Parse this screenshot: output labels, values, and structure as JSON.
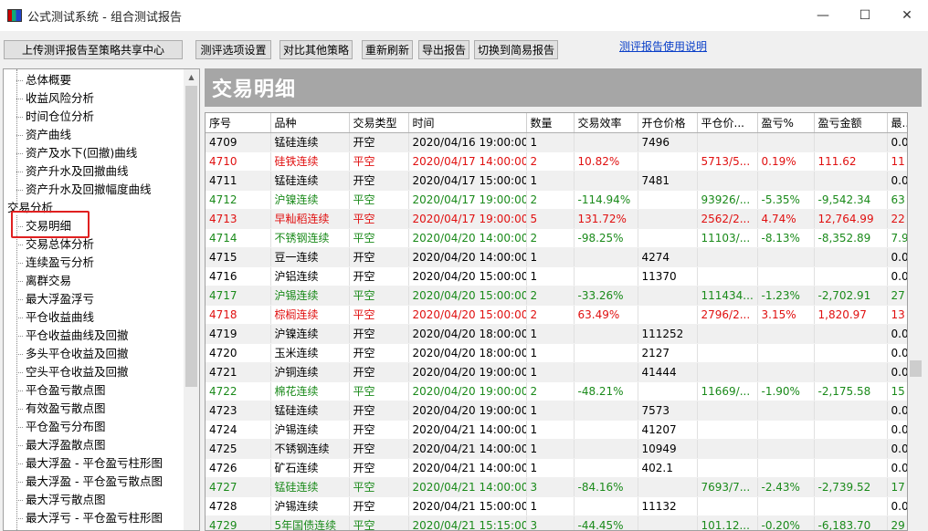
{
  "window": {
    "title": "公式测试系统 - 组合测试报告",
    "controls": {
      "minimize": "—",
      "maximize": "☐",
      "close": "✕"
    }
  },
  "toolbar": {
    "upload": "上传测评报告至策略共享中心",
    "options": "测评选项设置",
    "compare": "对比其他策略",
    "refresh": "重新刷新",
    "export": "导出报告",
    "switch": "切换到简易报告",
    "help_link": "测评报告使用说明"
  },
  "sidebar": {
    "items": [
      {
        "label": "总体概要",
        "child": true
      },
      {
        "label": "收益风险分析",
        "child": true
      },
      {
        "label": "时间仓位分析",
        "child": true
      },
      {
        "label": "资产曲线",
        "child": true
      },
      {
        "label": "资产及水下(回撤)曲线",
        "child": true
      },
      {
        "label": "资产升水及回撤曲线",
        "child": true
      },
      {
        "label": "资产升水及回撤幅度曲线",
        "child": true
      },
      {
        "label": "交易分析",
        "child": false
      },
      {
        "label": "交易明细",
        "child": true,
        "selected": true
      },
      {
        "label": "交易总体分析",
        "child": true
      },
      {
        "label": "连续盈亏分析",
        "child": true
      },
      {
        "label": "离群交易",
        "child": true
      },
      {
        "label": "最大浮盈浮亏",
        "child": true
      },
      {
        "label": "平仓收益曲线",
        "child": true
      },
      {
        "label": "平仓收益曲线及回撤",
        "child": true
      },
      {
        "label": "多头平仓收益及回撤",
        "child": true
      },
      {
        "label": "空头平仓收益及回撤",
        "child": true
      },
      {
        "label": "平仓盈亏散点图",
        "child": true
      },
      {
        "label": "有效盈亏散点图",
        "child": true
      },
      {
        "label": "平仓盈亏分布图",
        "child": true
      },
      {
        "label": "最大浮盈散点图",
        "child": true
      },
      {
        "label": "最大浮盈 - 平仓盈亏柱形图",
        "child": true
      },
      {
        "label": "最大浮盈 - 平仓盈亏散点图",
        "child": true
      },
      {
        "label": "最大浮亏散点图",
        "child": true
      },
      {
        "label": "最大浮亏 - 平仓盈亏柱形图",
        "child": true
      },
      {
        "label": "最大浮亏 - 平仓盈亏散点图",
        "child": true
      }
    ]
  },
  "main": {
    "section_title": "交易明细",
    "columns": [
      "序号",
      "品种",
      "交易类型",
      "时间",
      "数量",
      "交易效率",
      "开仓价格",
      "平仓价...",
      "盈亏%",
      "盈亏金额",
      "最..."
    ],
    "rows": [
      {
        "style": "black",
        "cells": [
          "4709",
          "锰硅连续",
          "开空",
          "2020/04/16 19:00:00",
          "1",
          "",
          "7496",
          "",
          "",
          "",
          "0.0"
        ]
      },
      {
        "style": "red",
        "cells": [
          "4710",
          "硅铁连续",
          "平空",
          "2020/04/17 14:00:00",
          "2",
          "10.82%",
          "",
          "5713/5...",
          "0.19%",
          "111.62",
          "11"
        ]
      },
      {
        "style": "black",
        "cells": [
          "4711",
          "锰硅连续",
          "开空",
          "2020/04/17 15:00:00",
          "1",
          "",
          "7481",
          "",
          "",
          "",
          "0.0"
        ]
      },
      {
        "style": "green",
        "cells": [
          "4712",
          "沪镍连续",
          "平空",
          "2020/04/17 19:00:00",
          "2",
          "-114.94%",
          "",
          "93926/...",
          "-5.35%",
          "-9,542.34",
          "63"
        ]
      },
      {
        "style": "red",
        "cells": [
          "4713",
          "早籼稻连续",
          "平空",
          "2020/04/17 19:00:00",
          "5",
          "131.72%",
          "",
          "2562/2...",
          "4.74%",
          "12,764.99",
          "22"
        ]
      },
      {
        "style": "green",
        "cells": [
          "4714",
          "不锈钢连续",
          "平空",
          "2020/04/20 14:00:00",
          "2",
          "-98.25%",
          "",
          "11103/...",
          "-8.13%",
          "-8,352.89",
          "7.9"
        ]
      },
      {
        "style": "black",
        "cells": [
          "4715",
          "豆一连续",
          "开空",
          "2020/04/20 14:00:00",
          "1",
          "",
          "4274",
          "",
          "",
          "",
          "0.0"
        ]
      },
      {
        "style": "black",
        "cells": [
          "4716",
          "沪铝连续",
          "开空",
          "2020/04/20 15:00:00",
          "1",
          "",
          "11370",
          "",
          "",
          "",
          "0.0"
        ]
      },
      {
        "style": "green",
        "cells": [
          "4717",
          "沪锡连续",
          "平空",
          "2020/04/20 15:00:00",
          "2",
          "-33.26%",
          "",
          "111434...",
          "-1.23%",
          "-2,702.91",
          "27"
        ]
      },
      {
        "style": "red",
        "cells": [
          "4718",
          "棕榈连续",
          "平空",
          "2020/04/20 15:00:00",
          "2",
          "63.49%",
          "",
          "2796/2...",
          "3.15%",
          "1,820.97",
          "13"
        ]
      },
      {
        "style": "black",
        "cells": [
          "4719",
          "沪镍连续",
          "开空",
          "2020/04/20 18:00:00",
          "1",
          "",
          "111252",
          "",
          "",
          "",
          "0.0"
        ]
      },
      {
        "style": "black",
        "cells": [
          "4720",
          "玉米连续",
          "开空",
          "2020/04/20 18:00:00",
          "1",
          "",
          "2127",
          "",
          "",
          "",
          "0.0"
        ]
      },
      {
        "style": "black",
        "cells": [
          "4721",
          "沪铜连续",
          "开空",
          "2020/04/20 19:00:00",
          "1",
          "",
          "41444",
          "",
          "",
          "",
          "0.0"
        ]
      },
      {
        "style": "green",
        "cells": [
          "4722",
          "棉花连续",
          "平空",
          "2020/04/20 19:00:00",
          "2",
          "-48.21%",
          "",
          "11669/...",
          "-1.90%",
          "-2,175.58",
          "15"
        ]
      },
      {
        "style": "black",
        "cells": [
          "4723",
          "锰硅连续",
          "开空",
          "2020/04/20 19:00:00",
          "1",
          "",
          "7573",
          "",
          "",
          "",
          "0.0"
        ]
      },
      {
        "style": "black",
        "cells": [
          "4724",
          "沪锡连续",
          "开空",
          "2020/04/21 14:00:00",
          "1",
          "",
          "41207",
          "",
          "",
          "",
          "0.0"
        ]
      },
      {
        "style": "black",
        "cells": [
          "4725",
          "不锈钢连续",
          "开空",
          "2020/04/21 14:00:00",
          "1",
          "",
          "10949",
          "",
          "",
          "",
          "0.0"
        ]
      },
      {
        "style": "black",
        "cells": [
          "4726",
          "矿石连续",
          "开空",
          "2020/04/21 14:00:00",
          "1",
          "",
          "402.1",
          "",
          "",
          "",
          "0.0"
        ]
      },
      {
        "style": "green",
        "cells": [
          "4727",
          "锰硅连续",
          "平空",
          "2020/04/21 14:00:00",
          "3",
          "-84.16%",
          "",
          "7693/7...",
          "-2.43%",
          "-2,739.52",
          "17"
        ]
      },
      {
        "style": "black",
        "cells": [
          "4728",
          "沪锡连续",
          "开空",
          "2020/04/21 15:00:00",
          "1",
          "",
          "11132",
          "",
          "",
          "",
          "0.0"
        ]
      },
      {
        "style": "green",
        "cells": [
          "4729",
          "5年国债连续",
          "平空",
          "2020/04/21 15:15:00",
          "3",
          "-44.45%",
          "",
          "101.12...",
          "-0.20%",
          "-6,183.70",
          "29"
        ]
      }
    ]
  },
  "colors": {
    "profit": "#e01010",
    "loss": "#1a8a1a",
    "header_band": "#a6a6a6",
    "link": "#0a3fc8",
    "selection_box": "#e02020"
  }
}
